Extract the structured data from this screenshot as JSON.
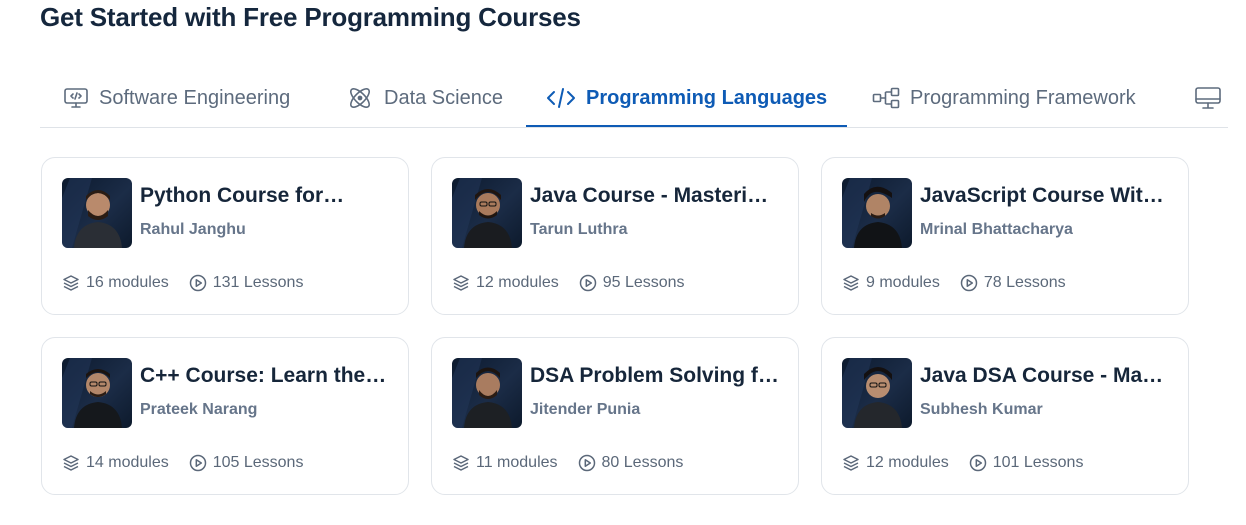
{
  "heading": "Get Started with Free Programming Courses",
  "tabs": [
    {
      "label": "Software Engineering",
      "icon": "code-monitor-icon"
    },
    {
      "label": "Data Science",
      "icon": "atom-icon"
    },
    {
      "label": "Programming Languages",
      "icon": "code-brackets-icon"
    },
    {
      "label": "Programming Framework",
      "icon": "flow-diagram-icon"
    },
    {
      "label": "",
      "icon": "monitor-icon"
    }
  ],
  "active_tab": "Programming Languages",
  "colors": {
    "accent": "#0e5bb5",
    "heading": "#15273d",
    "muted": "#5d6b7d"
  },
  "courses": [
    {
      "title": "Python Course for…",
      "author": "Rahul Janghu",
      "modules": "16 modules",
      "lessons": "131 Lessons"
    },
    {
      "title": "Java Course - Masterin…",
      "author": "Tarun Luthra",
      "modules": "12 modules",
      "lessons": "95 Lessons"
    },
    {
      "title": "JavaScript Course With…",
      "author": "Mrinal Bhattacharya",
      "modules": "9 modules",
      "lessons": "78 Lessons"
    },
    {
      "title": "C++ Course: Learn the…",
      "author": "Prateek Narang",
      "modules": "14 modules",
      "lessons": "105 Lessons"
    },
    {
      "title": "DSA Problem Solving f…",
      "author": "Jitender Punia",
      "modules": "11 modules",
      "lessons": "80 Lessons"
    },
    {
      "title": "Java DSA Course - Mast…",
      "author": "Subhesh Kumar",
      "modules": "12 modules",
      "lessons": "101 Lessons"
    }
  ]
}
